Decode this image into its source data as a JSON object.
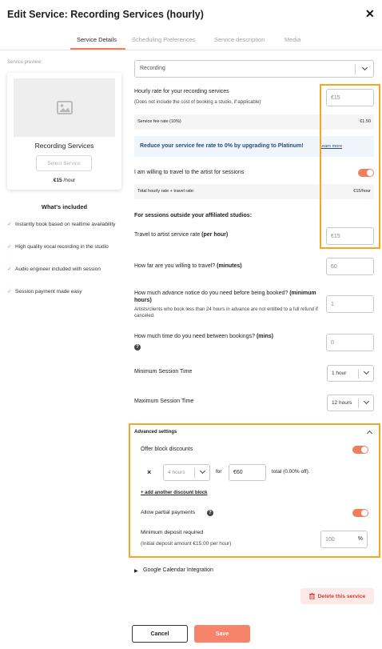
{
  "header": {
    "title": "Edit Service: Recording Services (hourly)",
    "close": "✕"
  },
  "tabs": [
    {
      "label": "Service Details"
    },
    {
      "label": "Scheduling Preferences"
    },
    {
      "label": "Service description"
    },
    {
      "label": "Media"
    }
  ],
  "preview": {
    "label": "Service preview:",
    "title": "Recording Services",
    "select_button": "Select Service",
    "price": "€15",
    "price_unit": "/hour"
  },
  "included": {
    "heading": "What's included",
    "items": [
      "Instantly book based on realtime availability",
      "High quality vocal recording in the studio",
      "Audio engineer included with session",
      "Session payment made easy"
    ]
  },
  "form": {
    "service_type": "Recording",
    "hourly_rate_label": "Hourly rate for your recording services",
    "hourly_rate_note": "(Does not include the cost of booking a studio, if applicable)",
    "hourly_rate_value": "€15",
    "fee_label": "Service fee rate (10%)",
    "fee_value": "€1.50",
    "promo_text": "Reduce your service fee rate to 0% by upgrading to Platinum!",
    "promo_link": "Learn more",
    "travel_label": "I am willing to travel to the artist for sessions",
    "total_label": "Total hourly rate + travel rate:",
    "total_value": "€15/hour",
    "outside_heading": "For sessions outside your affiliated studios:",
    "travel_rate_label": "Travel to artist service rate",
    "travel_rate_suffix": "(per hour)",
    "travel_rate_value": "€15",
    "distance_label": "How far are you willing to travel?",
    "distance_suffix": "(minutes)",
    "distance_value": "60",
    "notice_label": "How much advance notice do you need before being booked?",
    "notice_suffix": "(minimum hours)",
    "notice_note": "Artists/clients who book less than 24 hours in advance are not entitled to a full refund if canceled.",
    "notice_value": "1",
    "between_label": "How much time do you need between bookings?",
    "between_suffix": "(mins)",
    "between_value": "0",
    "min_session_label": "Minimum Session Time",
    "min_session_value": "1 hour",
    "max_session_label": "Maximum Session Time",
    "max_session_value": "12 hours"
  },
  "advanced": {
    "heading": "Advanced settings",
    "block_label": "Offer block discounts",
    "remove": "×",
    "block_hours": "4 hours",
    "for_label": "for",
    "block_price": "€60",
    "block_total": "total (0.00% off).",
    "add_link": "+ add another discount block",
    "partial_label": "Allow partial payments",
    "deposit_label": "Minimum deposit required",
    "deposit_note": "(Initial deposit amount €15.00 per hour)",
    "deposit_value": "100",
    "deposit_unit": "%"
  },
  "google_calendar": "Google Calendar Integration",
  "buttons": {
    "delete": "Delete this service",
    "cancel": "Cancel",
    "save": "Save"
  },
  "colors": {
    "accent": "#f07e5d",
    "highlight": "#f5a623",
    "promo_bg": "#eef6fb",
    "danger": "#d93b2f"
  }
}
